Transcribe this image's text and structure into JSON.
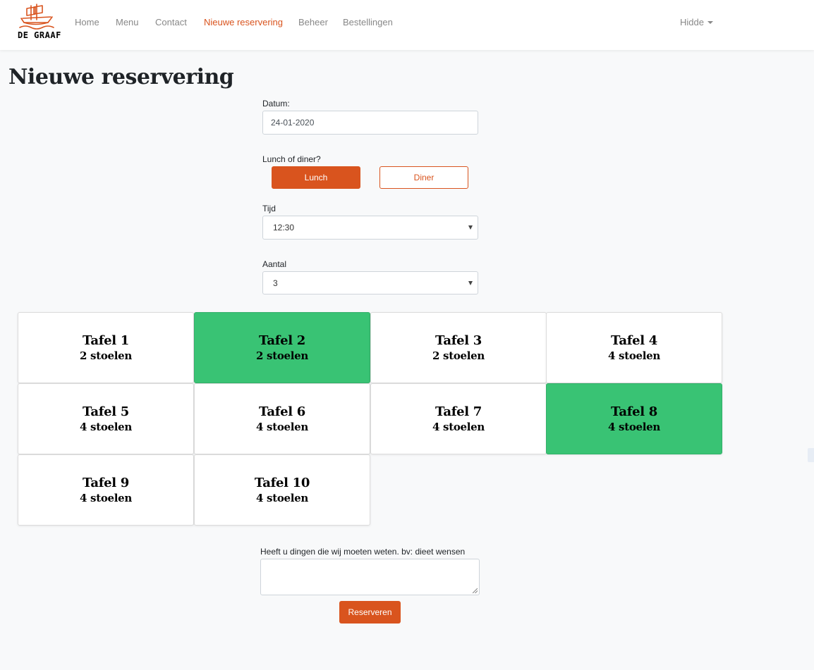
{
  "brand": {
    "logo_text": "DE GRAAF",
    "accent_color": "#d9541e",
    "selected_color": "#39c374"
  },
  "nav": {
    "items": [
      {
        "label": "Home",
        "active": false
      },
      {
        "label": "Menu",
        "active": false
      },
      {
        "label": "Contact",
        "active": false
      },
      {
        "label": "Nieuwe reservering",
        "active": true
      },
      {
        "label": "Beheer",
        "active": false
      },
      {
        "label": "Bestellingen",
        "active": false
      }
    ],
    "user": "Hidde"
  },
  "page": {
    "title": "Nieuwe reservering"
  },
  "form": {
    "datum_label": "Datum:",
    "datum_value": "24-01-2020",
    "meal_label": "Lunch of diner?",
    "lunch_label": "Lunch",
    "diner_label": "Diner",
    "selected_meal": "Lunch",
    "tijd_label": "Tijd",
    "tijd_value": "12:30",
    "aantal_label": "Aantal",
    "aantal_value": "3",
    "notes_label": "Heeft u dingen die wij moeten weten. bv: dieet wensen",
    "notes_value": "",
    "submit_label": "Reserveren"
  },
  "tables": [
    {
      "name": "Tafel 1",
      "seats": "2 stoelen",
      "selected": false
    },
    {
      "name": "Tafel 2",
      "seats": "2 stoelen",
      "selected": true
    },
    {
      "name": "Tafel 3",
      "seats": "2 stoelen",
      "selected": false
    },
    {
      "name": "Tafel 4",
      "seats": "4 stoelen",
      "selected": false
    },
    {
      "name": "Tafel 5",
      "seats": "4 stoelen",
      "selected": false
    },
    {
      "name": "Tafel 6",
      "seats": "4 stoelen",
      "selected": false
    },
    {
      "name": "Tafel 7",
      "seats": "4 stoelen",
      "selected": false
    },
    {
      "name": "Tafel 8",
      "seats": "4 stoelen",
      "selected": true
    },
    {
      "name": "Tafel 9",
      "seats": "4 stoelen",
      "selected": false
    },
    {
      "name": "Tafel 10",
      "seats": "4 stoelen",
      "selected": false
    }
  ]
}
